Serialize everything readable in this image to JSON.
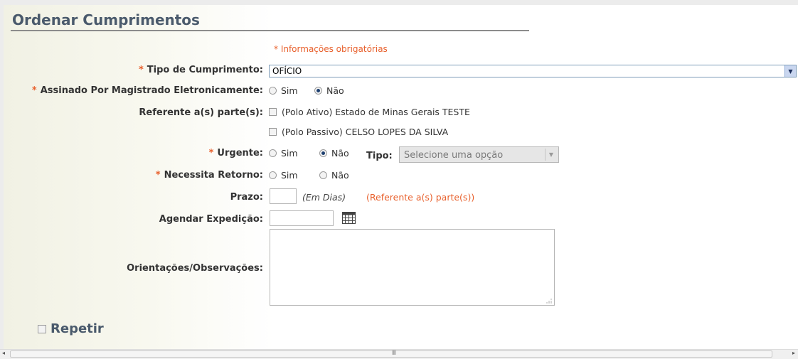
{
  "title": "Ordenar Cumprimentos",
  "required_note": "* Informações obrigatórias",
  "required_mark": "*",
  "tipo_cumprimento": {
    "label": "Tipo de Cumprimento:",
    "value": "OFÍCIO"
  },
  "assinado": {
    "label": "Assinado Por Magistrado Eletronicamente:",
    "options": [
      "Sim",
      "Não"
    ],
    "selected": "Não"
  },
  "referente": {
    "label": "Referente a(s) parte(s):",
    "partes": [
      "(Polo Ativo) Estado de Minas Gerais TESTE",
      "(Polo Passivo) CELSO LOPES DA SILVA"
    ]
  },
  "urgente": {
    "label": "Urgente:",
    "options": [
      "Sim",
      "Não"
    ],
    "selected": "Não",
    "tipo_label": "Tipo:",
    "tipo_placeholder": "Selecione uma opção"
  },
  "necessita_retorno": {
    "label": "Necessita Retorno:",
    "options": [
      "Sim",
      "Não"
    ],
    "selected": null
  },
  "prazo": {
    "label": "Prazo:",
    "unit_hint": "(Em Dias)",
    "ref_hint": "(Referente a(s) parte(s))",
    "value": ""
  },
  "agendar": {
    "label": "Agendar Expedição:",
    "value": ""
  },
  "orientacoes": {
    "label": "Orientações/Observações:",
    "value": ""
  },
  "repetir": {
    "label": "Repetir"
  },
  "scrollbar": {
    "grip": "III"
  }
}
